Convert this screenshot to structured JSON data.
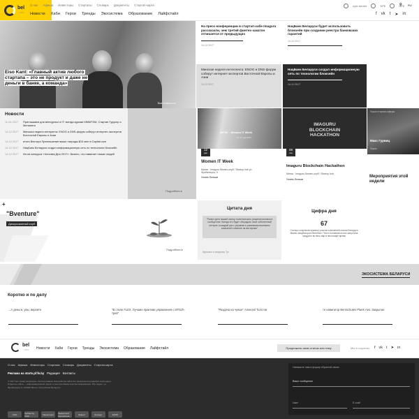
{
  "header": {
    "logo_name": "bel",
    "logo_sub": "· >>>",
    "top_links": [
      "О нас",
      "Афиша",
      "Инвесторы",
      "Стартапы",
      "Словарь",
      "Документы",
      "Стартап-карта"
    ],
    "nav": [
      "Новости",
      "Хаби",
      "Герои",
      "Тренды",
      "Экосистема",
      "Образование",
      "Лайфстайл"
    ],
    "rates_label": "курс валют",
    "rate_usd": "БРБ",
    "rate_eur": "БРБ",
    "lang": "RU"
  },
  "hero": {
    "title": "Eiso Kant: «Главный актив любого стартапа – это не продукт и даже не деньги в банке, а команда»",
    "all_news": "Все новости"
  },
  "tiles": {
    "t1": {
      "title": "На пресс-конференции в стартап-хабе Imaguru рассказали, чем третий финтех-хакатон отличается от предыдущих",
      "meta": "14.12.2017"
    },
    "t2": {
      "title": "НацБанк Беларуси будет использовать блокчейн при создании реестра банковских гарантий",
      "meta": "14.12.2017"
    },
    "t3": {
      "title": "Минская неделя интеллекта: ENOG и DNS-форум соберут интернет-экспертов Восточной Европы и Азии",
      "meta": "14.12.2017"
    },
    "t4": {
      "title": "НацБанк Беларуси создал информационную сеть по технологии блокчейн",
      "meta": "14.12.2017"
    },
    "women": {
      "title": "Women IT Week",
      "day": "12",
      "month": "дек",
      "place": "Минск · Imaguru бизнес-клуб / Startup hub ул. Фробениуса, 9",
      "link": "Узнать больше",
      "img_text": "WITW – Women IT Week",
      "img_sub": "11–17 дек 2017"
    },
    "hack": {
      "title": "Imaguru Blockchain Hackathon",
      "day": "08",
      "month": "сен",
      "place": "Минск · Imaguru бизнес-клуб / Startup hub",
      "link": "Узнать больше",
      "img_text": "IMAGURU BLOCKCHAIN HACKATHON"
    },
    "person": {
      "name": "Макс Гурвиц",
      "tag": "Герои",
      "img_caption": "Герои стартап-сферы"
    },
    "events_label": "Мероприятия этой недели"
  },
  "ad": {
    "line1": "240",
    "line2": "*",
    "line3": "400px"
  },
  "news": {
    "heading": "Новости",
    "more": "Подробнее",
    "items": [
      {
        "date": "11.04.2017",
        "text": "Приглашаем для венчурных в IT: всегда курими MMMTSM, Стартап Гурусер и Меланета"
      },
      {
        "date": "14.12.2017",
        "text": "Минская неделя интернета: ENOG и DNS-форум соберут интернет-экспертов Восточной Европы и Азии"
      },
      {
        "date": "14.12.2017",
        "text": "итоги Вектора Приглашение выше награды $10 млн в Capital.com"
      },
      {
        "date": "14.12.2017",
        "text": "НацБанк Беларуси создал информационную сеть по технологии блокчейн"
      },
      {
        "date": "14.12.2017",
        "text": "Итоги конкурса «Человек Дня 2017»: Бизнес, что навигает наших людей"
      }
    ]
  },
  "bventure": {
    "title": "\"Bventure\"",
    "tag": "Дискуссионный клуб",
    "more": "Подробнее",
    "plus": "+"
  },
  "quote": {
    "title": "Цитата дня",
    "text": "\"Ранее гдето ваший сектор политического решения возника в сообществе. Всегда его будет обсуждать свой собственный интерес и каждый раз с управлять уязвимыми влиянием компаний и имение на все время\"",
    "author": "Идеалист и владелец Тут"
  },
  "figure": {
    "title": "Цифра дня",
    "number": "67",
    "text": "Столько стартапов приняли участие в весенней сессии Беларуси бизнес-инкубатора в Витебске. Почти половина из них запустила продукты во весь мир в настоящее время"
  },
  "ecosystem": {
    "label": "ЭКОСИСТЕМА БЕЛАРУСИ"
  },
  "short": {
    "heading": "Коротко и по делу",
    "items": [
      "...А деньги, увы, верните",
      "\"В стиле FLEX. Лучшие практики управления с MTSzh-трей\"",
      "\"Раздача на чужое\" Алексей Толстов",
      "те навигатор Bernschutes PlanК Aes. Закрытие"
    ]
  },
  "bottom_nav": {
    "items": [
      "Новости",
      "Хаби",
      "Герои",
      "Тренды",
      "Экосистема",
      "Образование",
      "Лайфстайл"
    ],
    "cta": "Предложить свою статью или тему",
    "social_label": "Мы в соцсетях"
  },
  "footer": {
    "links": [
      "О нас",
      "Афиша",
      "Инвесторы",
      "Стартапы",
      "Словарь",
      "Документы",
      "Стартап-карта"
    ],
    "ad_line": "Реклама на starts.pf.fe.by",
    "ad_links": [
      "Редакция",
      "Контакты"
    ],
    "legal": "© 2017 все права защищены. Использование материалов сайта без разрешения редакции запрещено. Издатель сайта — информационный проект в реестре Министерства информации. Юр. адрес: ул. Фробениуса, 9, 220000 Минск, Республика Беларусь",
    "form_title": "Напишите нам в форму обратной связи",
    "form_message": "Ваше сообщение",
    "form_name": "Имя*",
    "form_email": "E-mail*",
    "payments": [
      "VISA",
      "Verified by VISA",
      "MasterCard",
      "MasterCard SecureCode",
      "Belkart",
      "Белкарт",
      "ЕРИП"
    ]
  }
}
